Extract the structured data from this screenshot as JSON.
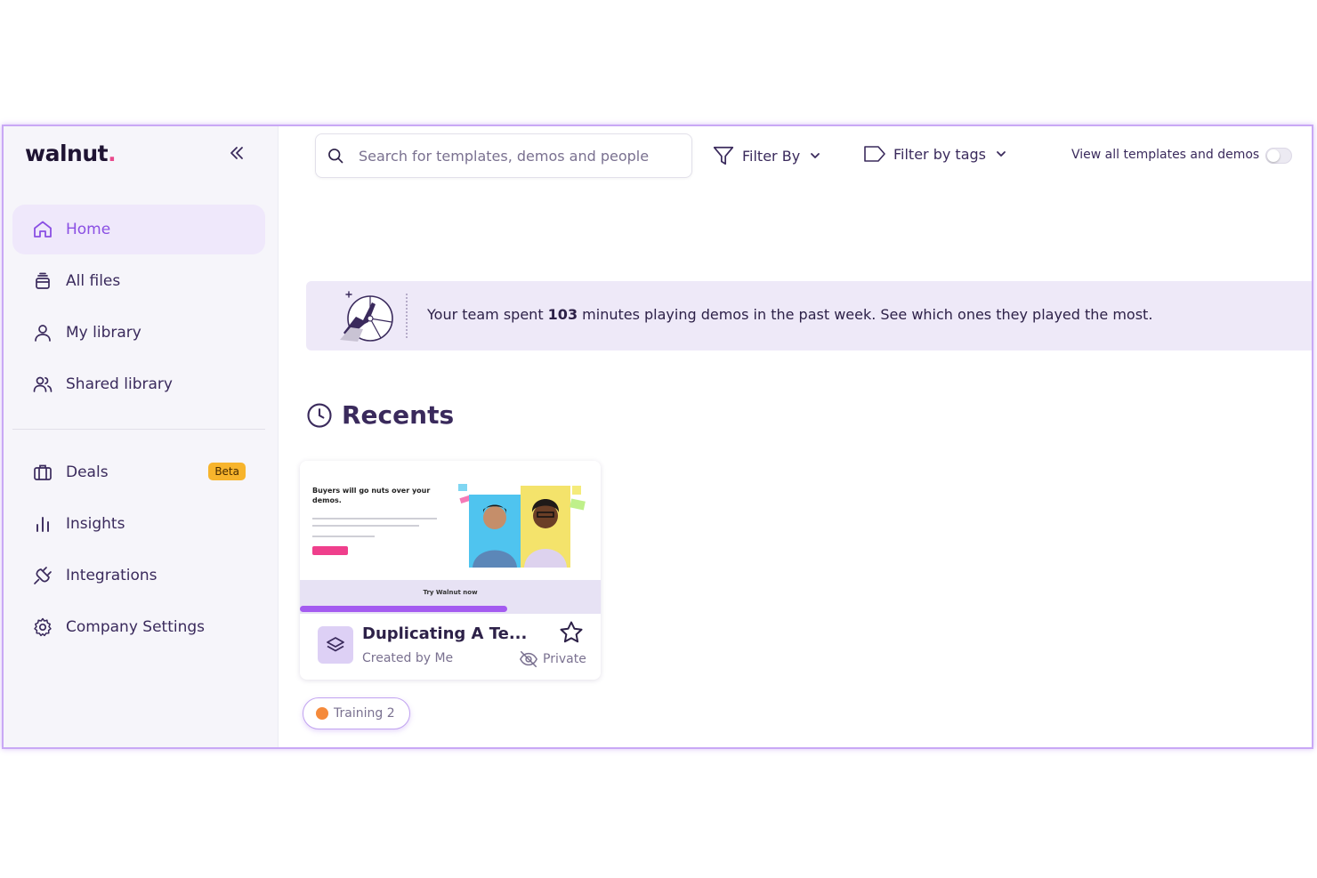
{
  "brand": {
    "name": "walnut",
    "dot": "."
  },
  "sidebar": {
    "collapse_icon": "chevron-double-left-icon",
    "items": [
      {
        "label": "Home",
        "icon": "home-icon",
        "active": true
      },
      {
        "label": "All files",
        "icon": "files-icon"
      },
      {
        "label": "My library",
        "icon": "user-icon"
      },
      {
        "label": "Shared library",
        "icon": "users-icon"
      },
      {
        "label": "Deals",
        "icon": "briefcase-icon",
        "badge": "Beta"
      },
      {
        "label": "Insights",
        "icon": "bar-chart-icon"
      },
      {
        "label": "Integrations",
        "icon": "plug-icon"
      },
      {
        "label": "Company Settings",
        "icon": "gear-icon"
      }
    ]
  },
  "topbar": {
    "search_placeholder": "Search for templates, demos and people",
    "filter_by": "Filter By",
    "filter_by_tags": "Filter by tags",
    "view_all_label": "View all templates and demos",
    "view_all_on": false
  },
  "banner": {
    "text_before": "Your team spent ",
    "minutes": "103",
    "text_after": " minutes playing demos in the past week. See which ones they played the most."
  },
  "recents": {
    "title": "Recents",
    "cards": [
      {
        "title": "Duplicating A Te...",
        "subtitle": "Created by Me",
        "visibility": "Private",
        "thumb_headline": "Buyers will go nuts over your demos.",
        "thumb_bar_text": "Try Walnut now",
        "thumb_progress": 0.69
      }
    ]
  },
  "tag": {
    "label": "Training 2",
    "color": "#f58a3b"
  },
  "colors": {
    "accent": "#8a4fe3",
    "sidebar_bg": "#f6f5fa",
    "banner_bg": "#eee9f8",
    "frame_border": "#c9a8f5"
  }
}
